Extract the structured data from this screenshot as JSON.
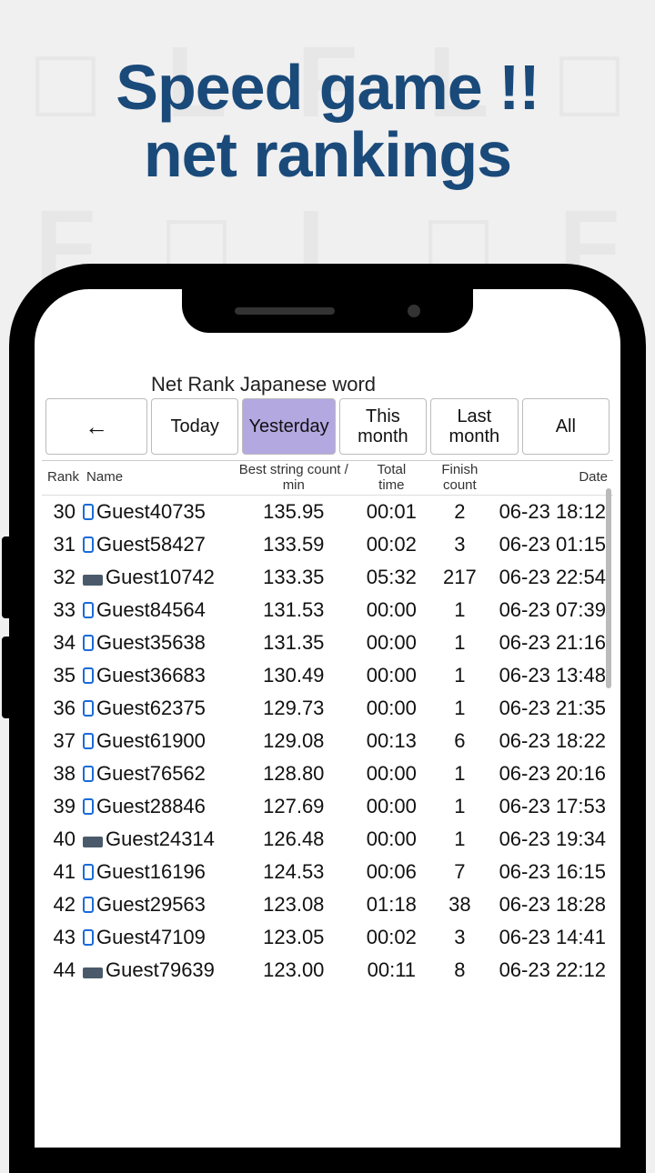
{
  "headline_line1": "Speed game !!",
  "headline_line2": "net rankings",
  "app_title": "Net Rank Japanese word",
  "back_arrow": "←",
  "tabs": {
    "today": "Today",
    "yesterday": "Yesterday",
    "this_month": "This month",
    "last_month": "Last month",
    "all": "All",
    "active_index": 1
  },
  "columns": {
    "rank": "Rank",
    "name": "Name",
    "best": "Best string count / min",
    "total": "Total time",
    "finish": "Finish count",
    "date": "Date"
  },
  "rows": [
    {
      "rank": 30,
      "device": "phone",
      "name": "Guest40735",
      "best": "135.95",
      "total": "00:01",
      "finish": 2,
      "date": "06-23 18:12"
    },
    {
      "rank": 31,
      "device": "phone",
      "name": "Guest58427",
      "best": "133.59",
      "total": "00:02",
      "finish": 3,
      "date": "06-23 01:15"
    },
    {
      "rank": 32,
      "device": "wide",
      "name": "Guest10742",
      "best": "133.35",
      "total": "05:32",
      "finish": 217,
      "date": "06-23 22:54"
    },
    {
      "rank": 33,
      "device": "phone",
      "name": "Guest84564",
      "best": "131.53",
      "total": "00:00",
      "finish": 1,
      "date": "06-23 07:39"
    },
    {
      "rank": 34,
      "device": "phone",
      "name": "Guest35638",
      "best": "131.35",
      "total": "00:00",
      "finish": 1,
      "date": "06-23 21:16"
    },
    {
      "rank": 35,
      "device": "phone",
      "name": "Guest36683",
      "best": "130.49",
      "total": "00:00",
      "finish": 1,
      "date": "06-23 13:48"
    },
    {
      "rank": 36,
      "device": "phone",
      "name": "Guest62375",
      "best": "129.73",
      "total": "00:00",
      "finish": 1,
      "date": "06-23 21:35"
    },
    {
      "rank": 37,
      "device": "phone",
      "name": "Guest61900",
      "best": "129.08",
      "total": "00:13",
      "finish": 6,
      "date": "06-23 18:22"
    },
    {
      "rank": 38,
      "device": "phone",
      "name": "Guest76562",
      "best": "128.80",
      "total": "00:00",
      "finish": 1,
      "date": "06-23 20:16"
    },
    {
      "rank": 39,
      "device": "phone",
      "name": "Guest28846",
      "best": "127.69",
      "total": "00:00",
      "finish": 1,
      "date": "06-23 17:53"
    },
    {
      "rank": 40,
      "device": "wide",
      "name": "Guest24314",
      "best": "126.48",
      "total": "00:00",
      "finish": 1,
      "date": "06-23 19:34"
    },
    {
      "rank": 41,
      "device": "phone",
      "name": "Guest16196",
      "best": "124.53",
      "total": "00:06",
      "finish": 7,
      "date": "06-23 16:15"
    },
    {
      "rank": 42,
      "device": "phone",
      "name": "Guest29563",
      "best": "123.08",
      "total": "01:18",
      "finish": 38,
      "date": "06-23 18:28"
    },
    {
      "rank": 43,
      "device": "phone",
      "name": "Guest47109",
      "best": "123.05",
      "total": "00:02",
      "finish": 3,
      "date": "06-23 14:41"
    },
    {
      "rank": 44,
      "device": "wide",
      "name": "Guest79639",
      "best": "123.00",
      "total": "00:11",
      "finish": 8,
      "date": "06-23 22:12"
    }
  ]
}
